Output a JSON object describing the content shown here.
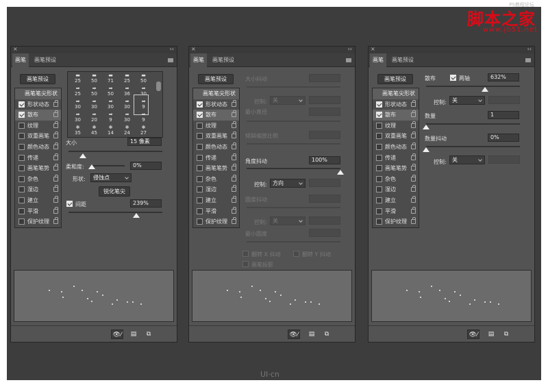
{
  "watermark": {
    "small": "PS教程论坛",
    "main": "脚本之家",
    "url": "www.jb51.net"
  },
  "bottom_logo": "UI·cn",
  "tabs": {
    "brush": "画笔",
    "brush_preset": "画笔预设"
  },
  "icons": {
    "close": "×",
    "collapse": "‹‹",
    "toggle_view": "👁⁄",
    "new_preset": "▤",
    "new_brush": "⧉"
  },
  "preset_button": "画笔预设",
  "list": {
    "header": "画笔笔尖形状",
    "items": [
      {
        "label": "形状动态"
      },
      {
        "label": "散布"
      },
      {
        "label": "纹理"
      },
      {
        "label": "双重画笔"
      },
      {
        "label": "颜色动态"
      },
      {
        "label": "传递"
      },
      {
        "label": "画笔笔势"
      },
      {
        "label": "杂色"
      },
      {
        "label": "湿边"
      },
      {
        "label": "建立"
      },
      {
        "label": "平滑"
      },
      {
        "label": "保护纹理"
      }
    ]
  },
  "panel1": {
    "checked": [
      true,
      true,
      false,
      false,
      false,
      false,
      false,
      false,
      false,
      false,
      false,
      false
    ],
    "brush_grid": {
      "rows": [
        [
          "25",
          "50",
          "71",
          "25",
          "50"
        ],
        [
          "25",
          "50",
          "50",
          "36",
          "30"
        ],
        [
          "30",
          "30",
          "30",
          "30",
          "9"
        ],
        [
          "30",
          "20",
          "9",
          "30",
          "9"
        ],
        [
          "35",
          "45",
          "14",
          "24",
          "27"
        ]
      ]
    },
    "size_label": "大小",
    "size_value": "15 像素",
    "size_level": 0.06,
    "softness_label": "柔和度:",
    "softness_value": "0%",
    "softness_level": 0.0,
    "shape_label": "形状:",
    "shape_value": "侵蚀点",
    "sharpen_button": "锐化笔尖",
    "spacing_label": "间距",
    "spacing_checked": true,
    "spacing_value": "239%",
    "spacing_level": 0.72
  },
  "panel2": {
    "checked": [
      true,
      true,
      false,
      false,
      false,
      false,
      false,
      false,
      false,
      false,
      false,
      false
    ],
    "size_jitter": "大小抖动",
    "control": "控制:",
    "off": "关",
    "min_diameter": "最小直径",
    "tilt_scale": "倾斜缩放比例",
    "angle_jitter": "角度抖动",
    "angle_value": "100%",
    "angle_level": 1.0,
    "direction": "方向",
    "roundness_jitter": "圆度抖动",
    "min_roundness": "最小圆度",
    "flip_x": "翻转 X 抖动",
    "flip_y": "翻转 Y 抖动",
    "brush_projection": "画笔投影"
  },
  "panel3": {
    "checked": [
      true,
      true,
      false,
      false,
      false,
      false,
      false,
      false,
      false,
      false,
      false,
      false
    ],
    "scatter_label": "散布",
    "both_axes_label": "两轴",
    "both_axes_checked": true,
    "scatter_value": "632%",
    "scatter_level": 0.63,
    "control": "控制:",
    "off": "关",
    "count_label": "数量",
    "count_value": "1",
    "count_level": 0.0,
    "count_jitter_label": "数量抖动",
    "count_jitter_value": "0%",
    "count_jitter_level": 0.0
  },
  "colors": {
    "panel": "#535353",
    "frame": "#3d3d3d",
    "watermark": "#d80c18"
  }
}
